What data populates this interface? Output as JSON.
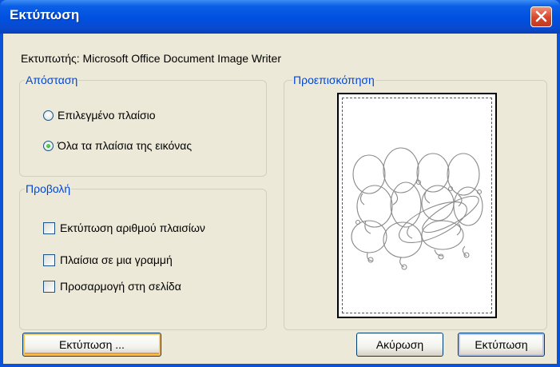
{
  "window": {
    "title": "Εκτύπωση"
  },
  "printer": {
    "label": "Εκτυπωτής: Microsoft Office Document Image Writer"
  },
  "distance": {
    "title": "Απόσταση",
    "options": [
      {
        "label": "Επιλεγμένο πλαίσιο",
        "checked": false
      },
      {
        "label": "Όλα τα πλαίσια της εικόνας",
        "checked": true
      }
    ]
  },
  "view": {
    "title": "Προβολή",
    "options": [
      {
        "label": "Εκτύπωση αριθμού πλαισίων",
        "checked": false
      },
      {
        "label": "Πλαίσια σε μια γραμμή",
        "checked": false
      },
      {
        "label": "Προσαρμογή στη σελίδα",
        "checked": false
      }
    ]
  },
  "preview": {
    "title": "Προεπισκόπηση"
  },
  "buttons": {
    "print_dots": "Εκτύπωση ...",
    "cancel": "Ακύρωση",
    "print": "Εκτύπωση"
  },
  "icons": {
    "close": "close-icon"
  },
  "colors": {
    "group_title": "#0046d5",
    "dialog_bg": "#ece9d8",
    "titlebar": "#0050e0",
    "close": "#d8452a"
  }
}
